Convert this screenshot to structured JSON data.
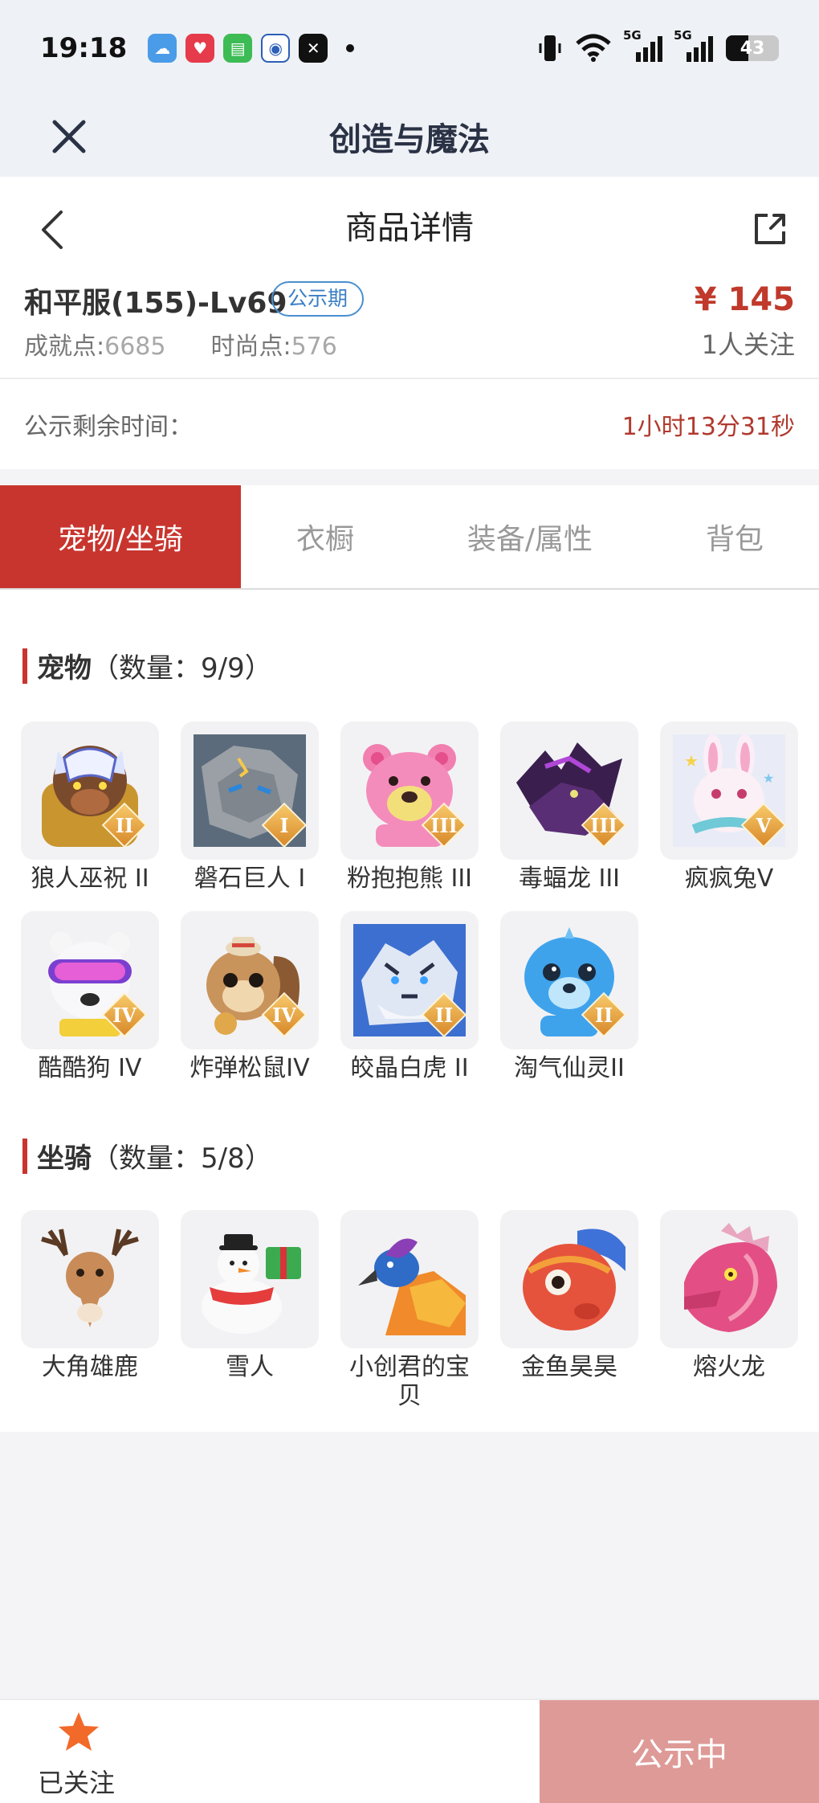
{
  "status_bar": {
    "time": "19:18",
    "signal_label_1": "5G",
    "signal_label_2": "5G",
    "battery_level": "43",
    "battery_fraction": 0.43
  },
  "app_header": {
    "title": "创造与魔法"
  },
  "page_header": {
    "title": "商品详情"
  },
  "product": {
    "name": "和平服(155)-Lv69",
    "badge": "公示期",
    "achievement_label": "成就点:",
    "achievement_value": "6685",
    "fashion_label": "时尚点:",
    "fashion_value": "576",
    "price": "¥ 145",
    "followers": "1人关注"
  },
  "timer": {
    "label": "公示剩余时间：",
    "value": "1小时13分31秒"
  },
  "tabs": [
    {
      "label": "宠物/坐骑",
      "active": true
    },
    {
      "label": "衣橱",
      "active": false
    },
    {
      "label": "装备/属性",
      "active": false
    },
    {
      "label": "背包",
      "active": false
    }
  ],
  "pets_section": {
    "title": "宠物",
    "count": "（数量：9/9）"
  },
  "pets": [
    {
      "name": "狼人巫祝 II",
      "rank": "II",
      "icon": "werewolf-icon"
    },
    {
      "name": "磐石巨人 I",
      "rank": "I",
      "icon": "rock-giant-icon"
    },
    {
      "name": "粉抱抱熊 III",
      "rank": "III",
      "icon": "pink-bear-icon"
    },
    {
      "name": "毒蝠龙 III",
      "rank": "III",
      "icon": "bat-dragon-icon"
    },
    {
      "name": "疯疯兔V",
      "rank": "V",
      "icon": "rabbit-icon"
    },
    {
      "name": "酷酷狗 IV",
      "rank": "IV",
      "icon": "cool-dog-icon"
    },
    {
      "name": "炸弹松鼠IV",
      "rank": "IV",
      "icon": "squirrel-icon"
    },
    {
      "name": "皎晶白虎 II",
      "rank": "II",
      "icon": "white-tiger-icon"
    },
    {
      "name": "淘气仙灵II",
      "rank": "II",
      "icon": "fairy-icon"
    }
  ],
  "mounts_section": {
    "title": "坐骑",
    "count": "（数量：5/8）"
  },
  "mounts": [
    {
      "name": "大角雄鹿",
      "icon": "deer-icon"
    },
    {
      "name": "雪人",
      "icon": "snowman-icon"
    },
    {
      "name": "小创君的宝贝",
      "icon": "phoenix-icon"
    },
    {
      "name": "金鱼昊昊",
      "icon": "goldfish-icon"
    },
    {
      "name": "熔火龙",
      "icon": "fire-dragon-icon"
    }
  ],
  "bottom_bar": {
    "follow_label": "已关注",
    "action_label": "公示中"
  },
  "colors": {
    "accent": "#c8352e",
    "badge": "#3a7fc4",
    "disabled_button": "#de9a97"
  }
}
